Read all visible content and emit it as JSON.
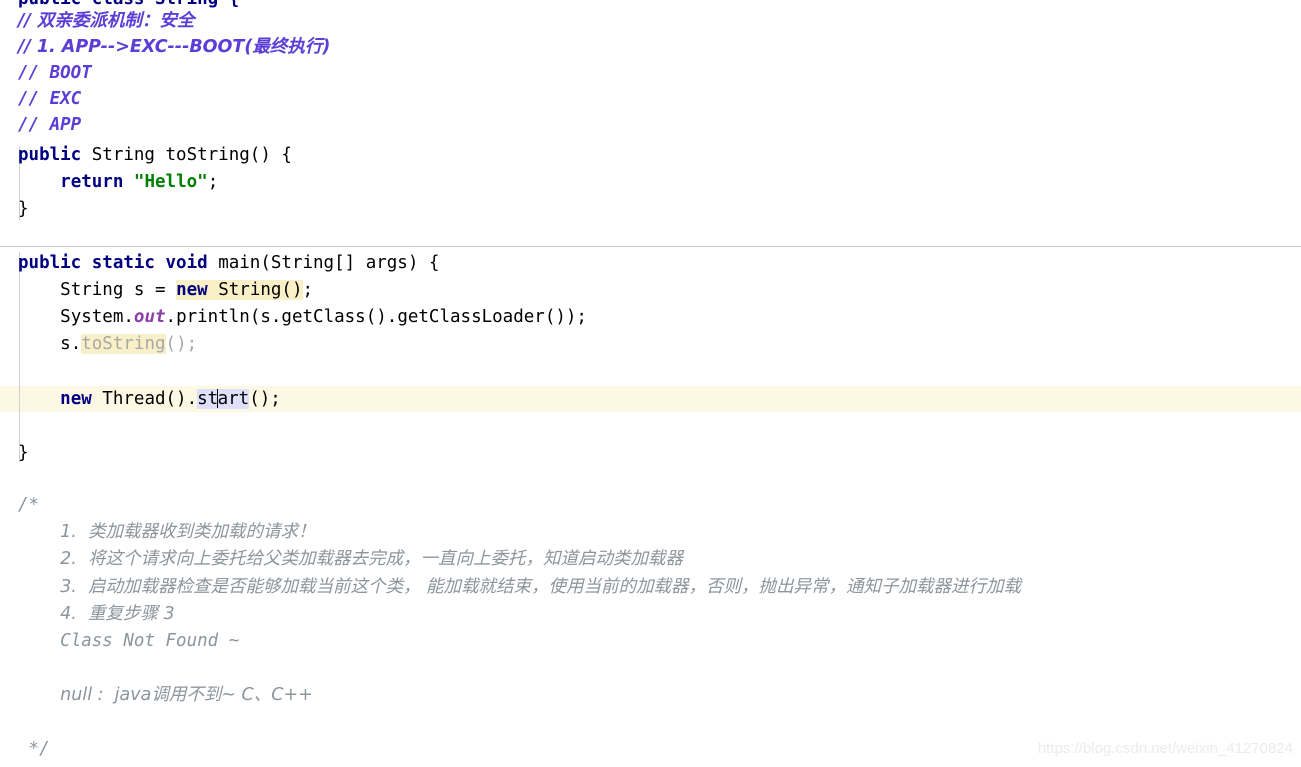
{
  "editor": {
    "language": "java",
    "background": "#ffffff",
    "caret_line_color": "#fdf8e4",
    "usage_highlight_color": "#dfdffa",
    "search_highlight_color": "#faf0c8",
    "comment_color": "#5b3ed6",
    "keyword_color": "#000080",
    "string_color": "#008000",
    "block_comment_color": "#8d959c",
    "static_field_color": "#8b3fa8"
  },
  "lines": {
    "l0_clipped": "public class String {",
    "l1_comment": "// 双亲委派机制：安全",
    "l2_comment": "// 1. APP-->EXC---BOOT(最终执行)",
    "l3_comment": "// BOOT",
    "l4_comment": "// EXC",
    "l5_comment": "// APP",
    "l6_kw_public": "public",
    "l6_rest": " String toString() {",
    "l7_kw_return": "return",
    "l7_string": "\"Hello\"",
    "l7_semi": ";",
    "l8_brace": "}",
    "l10_kw": "public static void",
    "l10_rest": " main(String[] args) {",
    "l11_pre": "String s = ",
    "l11_kw_new": "new",
    "l11_hl_rest": " String()",
    "l11_semi": ";",
    "l12_sys": "System.",
    "l12_out": "out",
    "l12_rest": ".println(s.getClass().getClassLoader());",
    "l13_pre": "s.",
    "l13_method": "toString",
    "l13_post": "();",
    "l15_kw_new": "new",
    "l15_mid": " Thread().",
    "l15_word_a": "st",
    "l15_word_b": "art",
    "l15_post": "();",
    "l17_brace": "}",
    "l19_open": "/*",
    "l20": "1.  类加载器收到类加载的请求！",
    "l21": "2.  将这个请求向上委托给父类加载器去完成，一直向上委托，知道启动类加载器",
    "l22": "3.  启动加载器检查是否能够加载当前这个类， 能加载就结束，使用当前的加载器，否则，抛出异常，通知子加载器进行加载",
    "l23": "4.  重复步骤 3",
    "l24": "Class Not Found ~",
    "l26": "null :  java调用不到~ C、C++",
    "l28_close": "*/"
  },
  "watermark": {
    "text": "https://blog.csdn.net/weixin_41270824"
  }
}
